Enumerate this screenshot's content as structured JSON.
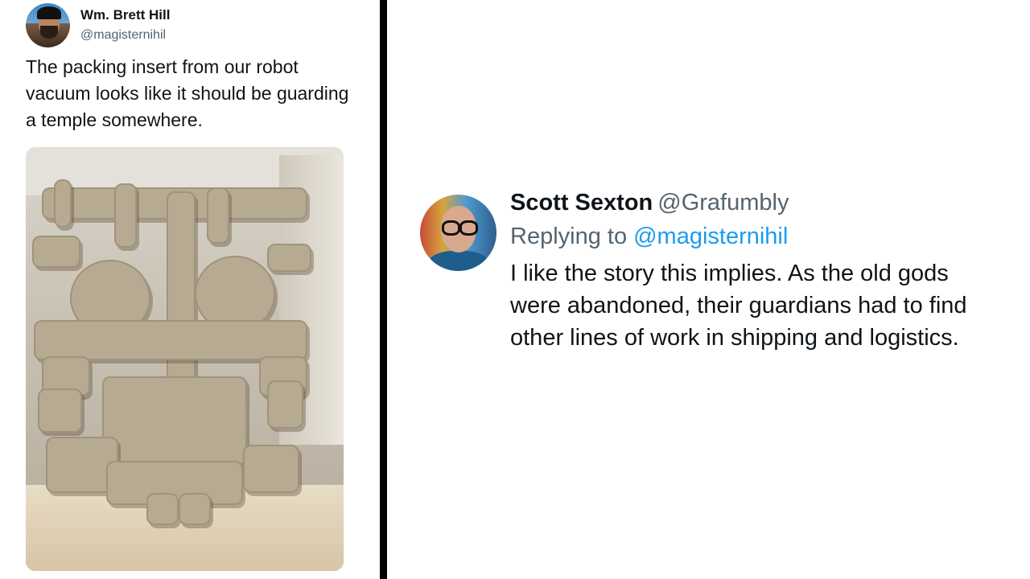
{
  "original_tweet": {
    "display_name": "Wm. Brett Hill",
    "handle": "@magisternihil",
    "text": "The packing insert from our robot vacuum looks like it should be guarding a temple somewhere."
  },
  "reply_tweet": {
    "display_name": "Scott Sexton",
    "handle": "@Grafumbly",
    "replying_label": "Replying to",
    "replying_to": "@magisternihil",
    "text": "I like the story this implies. As the old gods were abandoned, their guardians had to find other lines of work in shipping and logistics."
  },
  "colors": {
    "text": "#0f1419",
    "secondary_text": "#536471",
    "link": "#1d9bf0",
    "divider": "#000000"
  }
}
